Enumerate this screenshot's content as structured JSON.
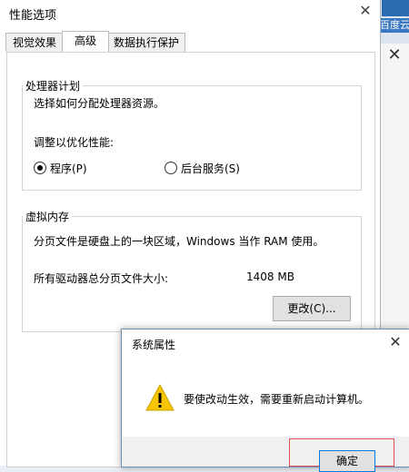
{
  "background": {
    "desktop_label": "百度云"
  },
  "perf_dialog": {
    "title": "性能选项",
    "close_glyph": "✕",
    "tabs": [
      "视觉效果",
      "高级",
      "数据执行保护"
    ],
    "active_tab": "高级",
    "processor": {
      "legend": "处理器计划",
      "description": "选择如何分配处理器资源。",
      "adjust_label": "调整以优化性能:",
      "options": [
        {
          "label": "程序(P)",
          "checked": true
        },
        {
          "label": "后台服务(S)",
          "checked": false
        }
      ]
    },
    "virtual_memory": {
      "legend": "虚拟内存",
      "description": "分页文件是硬盘上的一块区域，Windows 当作 RAM 使用。",
      "total_label": "所有驱动器总分页文件大小:",
      "total_value": "1408 MB",
      "change_button": "更改(C)..."
    }
  },
  "sys_dialog": {
    "title": "系统属性",
    "close_glyph": "✕",
    "message": "要使改动生效，需要重新启动计算机。",
    "ok_button": "确定"
  },
  "colors": {
    "warning_yellow": "#f7c600",
    "focus_blue": "#0078d7",
    "highlight_red": "#e35050"
  }
}
